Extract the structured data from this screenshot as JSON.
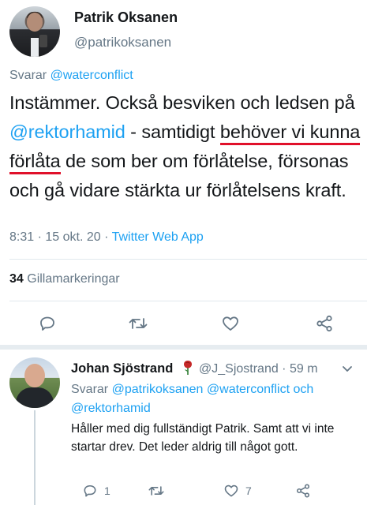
{
  "main_tweet": {
    "author": {
      "display_name": "Patrik Oksanen",
      "handle": "@patrikoksanen"
    },
    "replying_label": "Svarar",
    "replying_to": "@waterconflict",
    "text_parts": {
      "p1": "Instämmer. Också besviken och ledsen på ",
      "mention": "@rektorhamid",
      "p2": " - samtidigt ",
      "underlined": "behöver vi kunna förlåta",
      "p3": " de som ber om förlåtelse, försonas och gå vidare stärkta ur förlåtelsens kraft."
    },
    "meta": {
      "time": "8:31",
      "date": "15 okt. 20",
      "separator": " · ",
      "source": "Twitter Web App"
    },
    "likes": {
      "count": "34",
      "label": "Gillamarkeringar"
    },
    "underline_color": "#e0102a"
  },
  "reply_tweet": {
    "author": {
      "display_name": "Johan Sjöstrand",
      "handle": "@J_Sjostrand",
      "age": "59 m",
      "separator": " · "
    },
    "replying_label": "Svarar",
    "replying_to_1": "@patrikoksanen",
    "replying_to_2": "@waterconflict",
    "replying_and": "och",
    "replying_to_3": "@rektorhamid",
    "text": "Håller med dig fullständigt Patrik. Samt att vi inte startar drev. Det leder aldrig till något gott.",
    "counts": {
      "replies": "1",
      "likes": "7"
    }
  },
  "icons": [
    "reply-icon",
    "retweet-icon",
    "like-icon",
    "share-icon",
    "chevron-down-icon",
    "rose-icon"
  ],
  "colors": {
    "link": "#1da1f2",
    "secondary_text": "#657786",
    "primary_text": "#14171a",
    "divider": "#e1e8ed"
  }
}
